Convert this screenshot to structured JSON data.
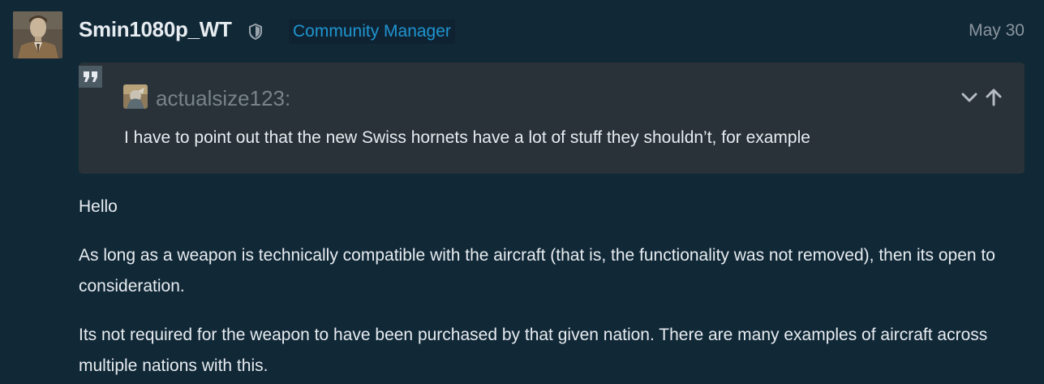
{
  "post": {
    "author": "Smin1080p_WT",
    "shield_icon": "shield-icon",
    "title_badge": "Community Manager",
    "date": "May 30",
    "accent_color": "#1f95cf",
    "background_color": "#112837"
  },
  "quote": {
    "quote_icon": "quote-icon",
    "author": "actualsize123:",
    "text": "I have to point out that the new Swiss hornets have a lot of stuff they shouldn’t, for example",
    "expand_icon": "chevron-down-icon",
    "goto_icon": "arrow-up-icon"
  },
  "content": {
    "paragraphs": [
      "Hello",
      "As long as a weapon is technically compatible with the aircraft (that is, the functionality was not removed), then its open to consideration.",
      "Its not required for the weapon to have been purchased by that given nation. There are many examples of aircraft across multiple nations with this."
    ]
  }
}
